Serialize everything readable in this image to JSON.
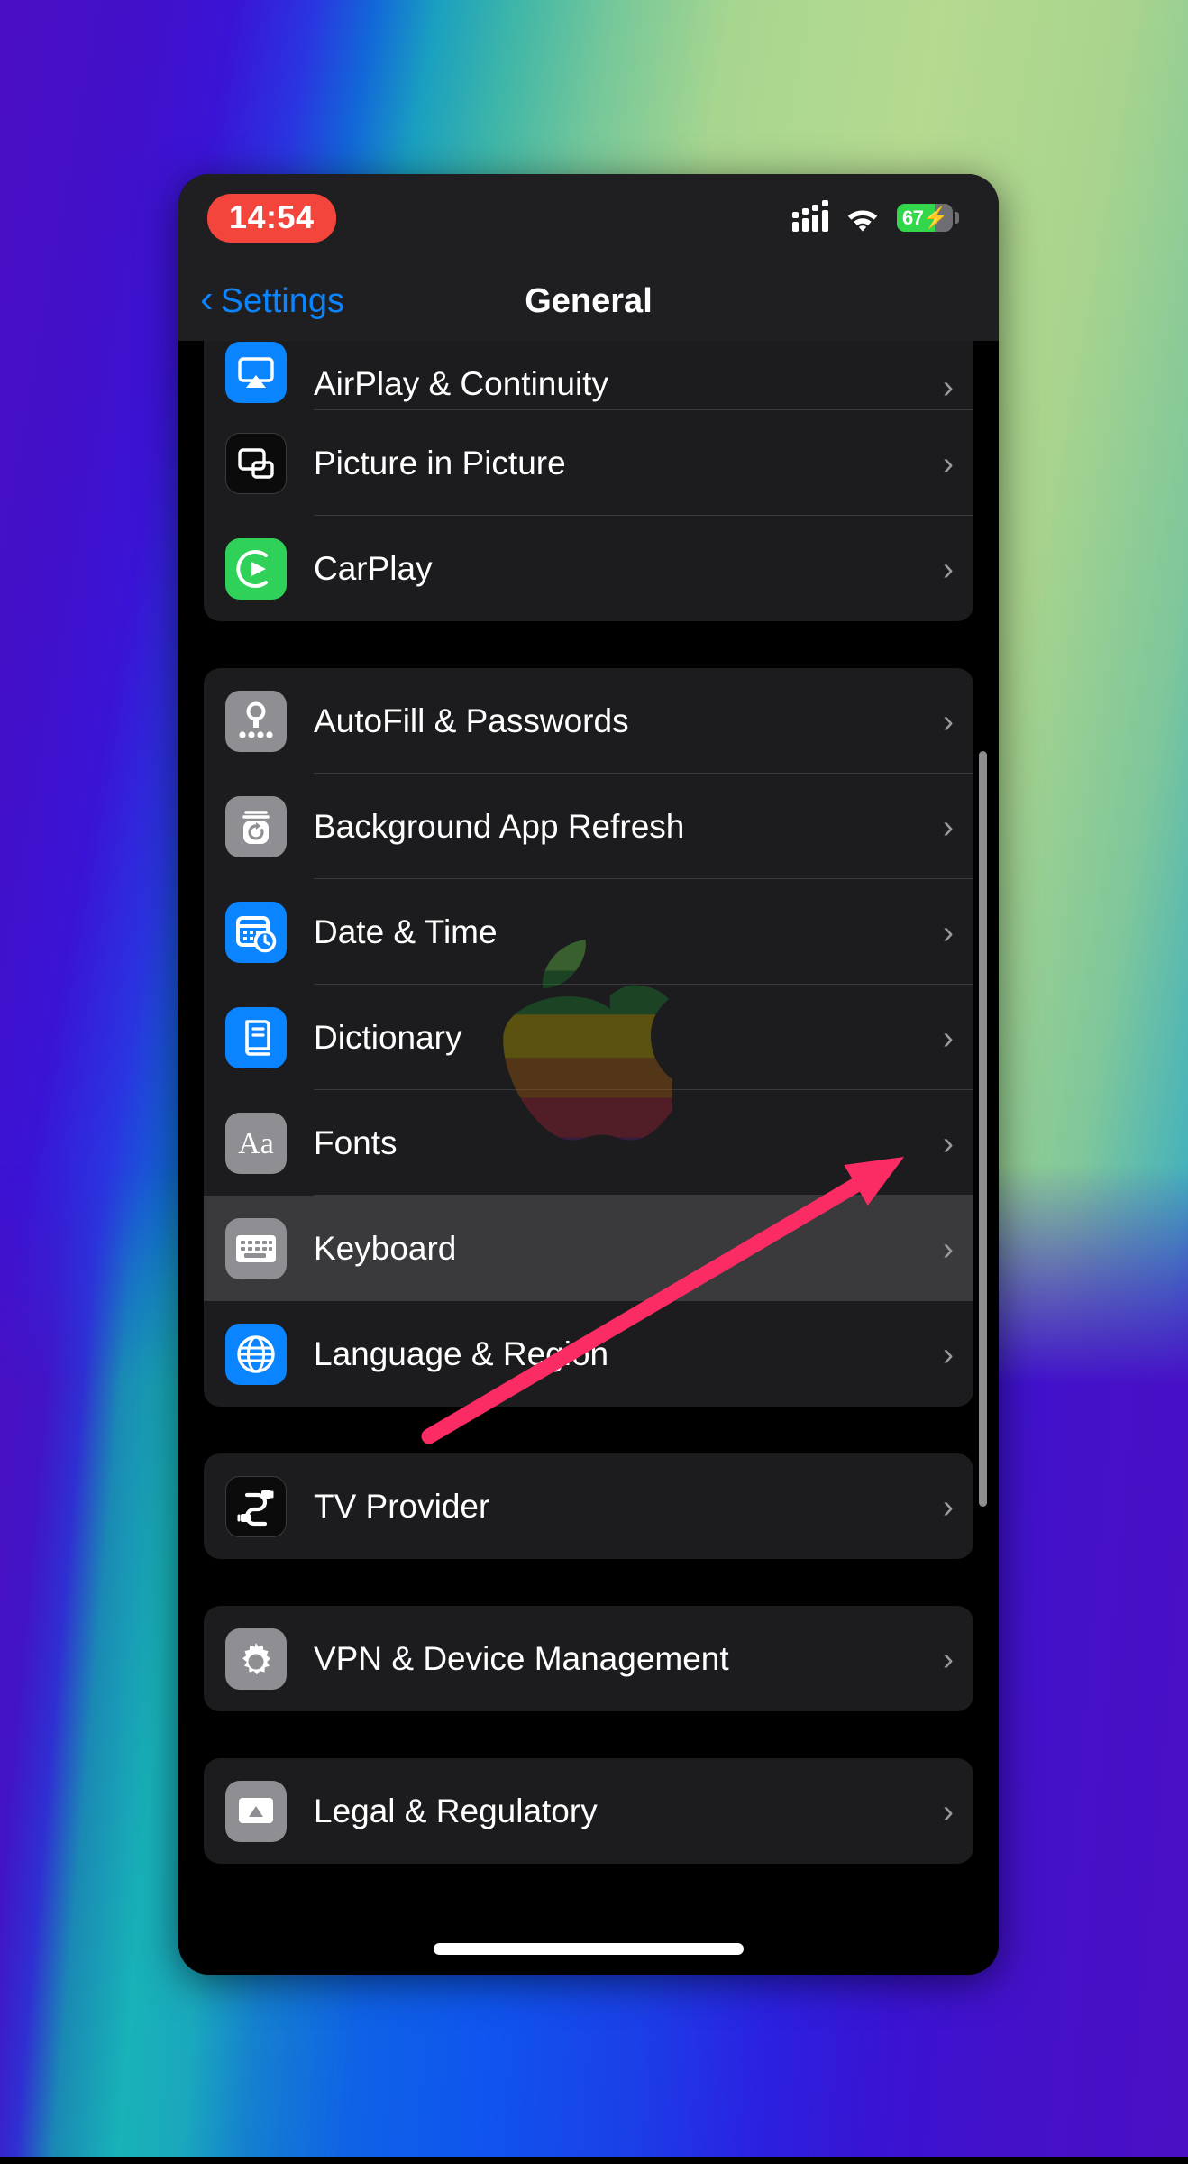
{
  "status_bar": {
    "time": "14:54",
    "signal_icon": "cellular-signal-icon",
    "wifi_icon": "wifi-icon",
    "battery_level": "67",
    "battery_charging": true,
    "battery_color": "#32D74B",
    "time_pill_color": "#F4453D"
  },
  "nav_bar": {
    "back_label": "Settings",
    "title": "General",
    "back_color": "#0A84FF"
  },
  "groups": [
    {
      "id": "group-media",
      "clipped_top": true,
      "rows": [
        {
          "label": "AirPlay & Continuity",
          "icon": "airplay-icon",
          "icon_bg": "#0A84FF",
          "chevron": "›",
          "selected": false
        },
        {
          "label": "Picture in Picture",
          "icon": "pip-icon",
          "icon_bg": "#0b0b0c",
          "chevron": "›",
          "selected": false
        },
        {
          "label": "CarPlay",
          "icon": "carplay-icon",
          "icon_bg": "#30D158",
          "chevron": "›",
          "selected": false
        }
      ]
    },
    {
      "id": "group-system",
      "clipped_top": false,
      "rows": [
        {
          "label": "AutoFill & Passwords",
          "icon": "key-icon",
          "icon_bg": "#8e8e93",
          "chevron": "›",
          "selected": false
        },
        {
          "label": "Background App Refresh",
          "icon": "refresh-icon",
          "icon_bg": "#8e8e93",
          "chevron": "›",
          "selected": false
        },
        {
          "label": "Date & Time",
          "icon": "calendar-clock-icon",
          "icon_bg": "#0A84FF",
          "chevron": "›",
          "selected": false
        },
        {
          "label": "Dictionary",
          "icon": "book-icon",
          "icon_bg": "#0A84FF",
          "chevron": "›",
          "selected": false
        },
        {
          "label": "Fonts",
          "icon": "fonts-aa-icon",
          "icon_bg": "#8e8e93",
          "chevron": "›",
          "selected": false
        },
        {
          "label": "Keyboard",
          "icon": "keyboard-icon",
          "icon_bg": "#8e8e93",
          "chevron": "›",
          "selected": true
        },
        {
          "label": "Language & Region",
          "icon": "globe-icon",
          "icon_bg": "#0A84FF",
          "chevron": "›",
          "selected": false
        }
      ]
    },
    {
      "id": "group-tv",
      "clipped_top": false,
      "rows": [
        {
          "label": "TV Provider",
          "icon": "tv-connector-icon",
          "icon_bg": "#0b0b0c",
          "chevron": "›",
          "selected": false
        }
      ]
    },
    {
      "id": "group-vpn",
      "clipped_top": false,
      "rows": [
        {
          "label": "VPN & Device Management",
          "icon": "gear-icon",
          "icon_bg": "#8e8e93",
          "chevron": "›",
          "selected": false
        }
      ]
    },
    {
      "id": "group-legal",
      "clipped_top": false,
      "partial_bottom": true,
      "rows": [
        {
          "label": "Legal & Regulatory",
          "icon": "legal-icon",
          "icon_bg": "#8e8e93",
          "chevron": "›",
          "selected": false
        }
      ]
    }
  ],
  "annotation": {
    "arrow_color": "#FB2C63",
    "points_to": "Keyboard"
  },
  "watermark": {
    "icon": "apple-rainbow-logo"
  }
}
